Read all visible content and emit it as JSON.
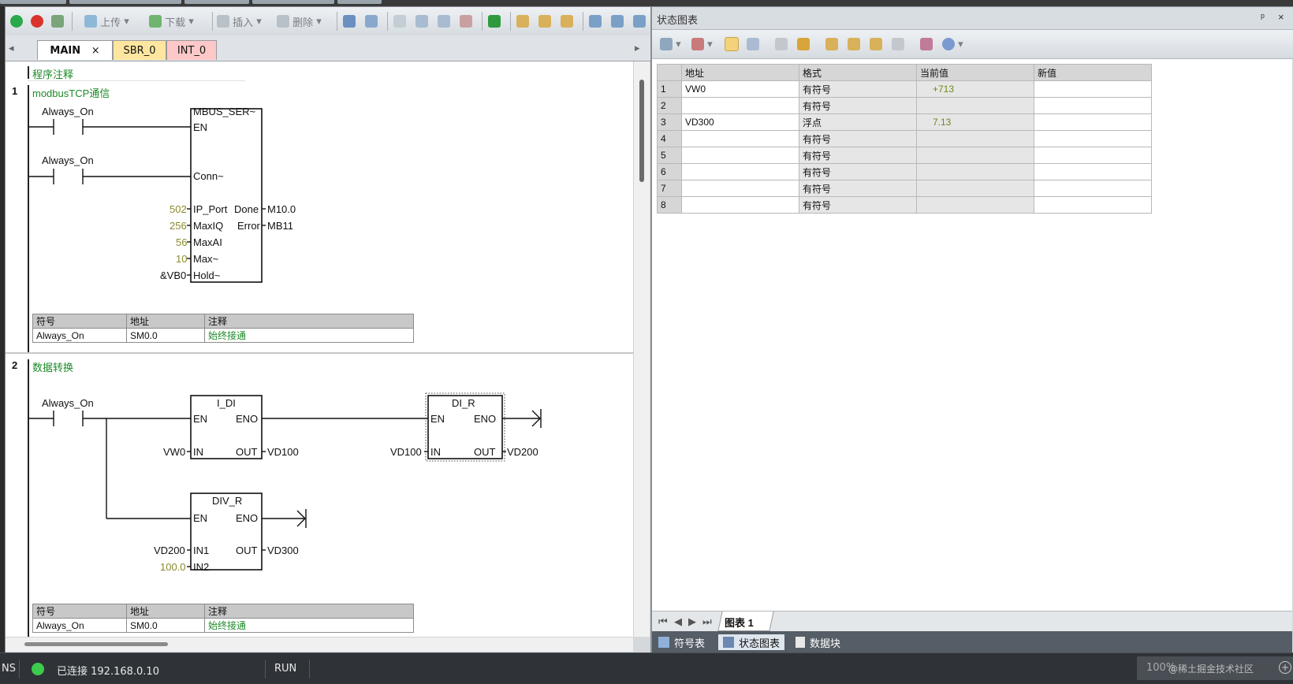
{
  "toolbar": {
    "upload_label": "上传",
    "download_label": "下载",
    "insert_label": "插入",
    "delete_label": "删除"
  },
  "tabs": [
    {
      "label": "MAIN",
      "close": "×",
      "color": "#ffffff"
    },
    {
      "label": "SBR_0",
      "color": "#ffe6a0"
    },
    {
      "label": "INT_0",
      "color": "#ffc8c8"
    }
  ],
  "program": {
    "comment": "程序注释",
    "networks": [
      {
        "number": "1",
        "title": "modbusTCP通信"
      },
      {
        "number": "2",
        "title": "数据转换"
      }
    ]
  },
  "net1": {
    "contact1": "Always_On",
    "contact2": "Always_On",
    "box_title": "MBUS_SER~",
    "pins_left": [
      "EN",
      "Conn~",
      "IP_Port",
      "MaxIQ",
      "MaxAI",
      "Max~",
      "Hold~"
    ],
    "pins_right": [
      "Done",
      "Error"
    ],
    "inputs": [
      "502",
      "256",
      "56",
      "10",
      "&VB0"
    ],
    "outputs": [
      "M10.0",
      "MB11"
    ]
  },
  "net2": {
    "contact": "Always_On",
    "box1": {
      "title": "I_DI",
      "en": "EN",
      "eno": "ENO",
      "in": "IN",
      "out": "OUT",
      "in_val": "VW0",
      "out_val": "VD100"
    },
    "box2": {
      "title": "DI_R",
      "en": "EN",
      "eno": "ENO",
      "in": "IN",
      "out": "OUT",
      "in_val": "VD100",
      "out_val": "VD200"
    },
    "box3": {
      "title": "DIV_R",
      "en": "EN",
      "eno": "ENO",
      "in1": "IN1",
      "in2": "IN2",
      "out": "OUT",
      "in1_val": "VD200",
      "in2_val": "100.0",
      "out_val": "VD300"
    }
  },
  "symtable": {
    "headers": [
      "符号",
      "地址",
      "注释"
    ],
    "row": [
      "Always_On",
      "SM0.0",
      "始终接通"
    ]
  },
  "chart": {
    "title": "状态图表",
    "pin": "ᵖ",
    "close": "×",
    "headers": [
      "地址",
      "格式",
      "当前值",
      "新值"
    ],
    "rows": [
      {
        "n": "1",
        "addr": "VW0",
        "fmt": "有符号",
        "cur": "+713",
        "new": ""
      },
      {
        "n": "2",
        "addr": "",
        "fmt": "有符号",
        "cur": "",
        "new": ""
      },
      {
        "n": "3",
        "addr": "VD300",
        "fmt": "浮点",
        "cur": "7.13",
        "new": ""
      },
      {
        "n": "4",
        "addr": "",
        "fmt": "有符号",
        "cur": "",
        "new": ""
      },
      {
        "n": "5",
        "addr": "",
        "fmt": "有符号",
        "cur": "",
        "new": ""
      },
      {
        "n": "6",
        "addr": "",
        "fmt": "有符号",
        "cur": "",
        "new": ""
      },
      {
        "n": "7",
        "addr": "",
        "fmt": "有符号",
        "cur": "",
        "new": ""
      },
      {
        "n": "8",
        "addr": "",
        "fmt": "有符号",
        "cur": "",
        "new": ""
      }
    ],
    "sheet_tab": "图表 1",
    "nav": [
      "⏮",
      "◀",
      "▶",
      "⏭"
    ]
  },
  "bottom_tabs": [
    "符号表",
    "状态图表",
    "数据块"
  ],
  "status": {
    "left": "NS",
    "connection": "已连接 192.168.0.10",
    "mode": "RUN",
    "zoom": "100%",
    "watermark": "@稀土掘金技术社区"
  }
}
